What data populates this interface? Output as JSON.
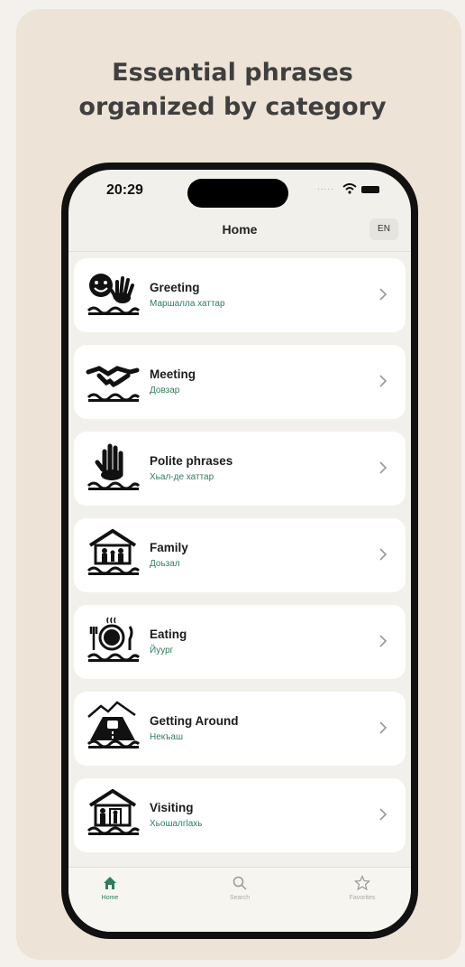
{
  "headline": {
    "line1": "Essential phrases",
    "line2": "organized by category"
  },
  "status_bar": {
    "time": "20:29",
    "signal": "....."
  },
  "nav": {
    "title": "Home",
    "language": "EN"
  },
  "categories": [
    {
      "title": "Greeting",
      "subtitle": "Маршалла хаттар",
      "icon": "greeting-icon"
    },
    {
      "title": "Meeting",
      "subtitle": "Довзар",
      "icon": "handshake-icon"
    },
    {
      "title": "Polite phrases",
      "subtitle": "Хьал-де хаттар",
      "icon": "hand-icon"
    },
    {
      "title": "Family",
      "subtitle": "Доьзал",
      "icon": "family-house-icon"
    },
    {
      "title": "Eating",
      "subtitle": "Йуург",
      "icon": "plate-icon"
    },
    {
      "title": "Getting Around",
      "subtitle": "Некъаш",
      "icon": "road-car-icon"
    },
    {
      "title": "Visiting",
      "subtitle": "Хьошалгlахь",
      "icon": "visit-house-icon"
    }
  ],
  "tabs": [
    {
      "label": "Home",
      "icon": "home-icon",
      "active": true
    },
    {
      "label": "Search",
      "icon": "search-icon",
      "active": false
    },
    {
      "label": "Favorites",
      "icon": "star-icon",
      "active": false
    }
  ],
  "colors": {
    "background": "#ede3d6",
    "accent": "#2f7d5b",
    "card": "#ffffff"
  }
}
